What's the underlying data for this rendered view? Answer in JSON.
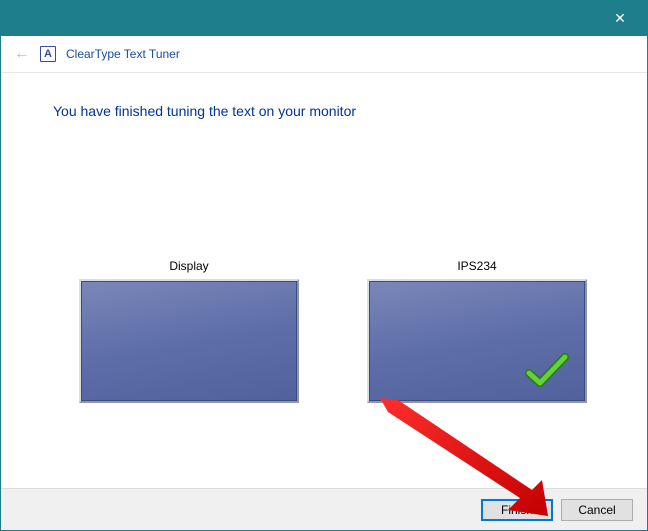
{
  "window": {
    "title": "ClearType Text Tuner",
    "app_icon_letter": "A"
  },
  "main": {
    "headline": "You have finished tuning the text on your monitor",
    "monitors": [
      {
        "label": "Display",
        "checked": false
      },
      {
        "label": "IPS234",
        "checked": true
      }
    ]
  },
  "footer": {
    "finish_label": "Finish",
    "cancel_label": "Cancel"
  }
}
